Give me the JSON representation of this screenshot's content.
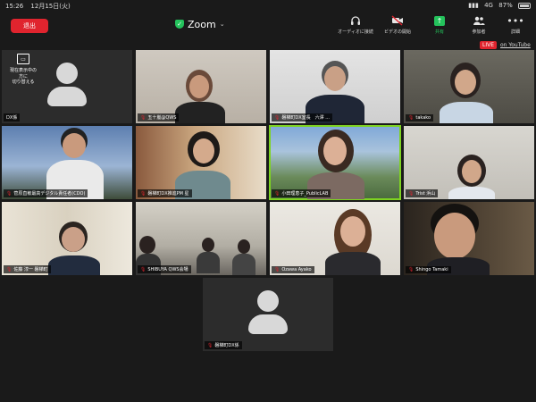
{
  "status": {
    "time": "15:26",
    "date": "12月15日(火)",
    "network": "4G",
    "battery": "87%"
  },
  "toolbar": {
    "leave_label": "退出",
    "title": "Zoom",
    "title_chevron": "⌄",
    "tools": [
      {
        "label": "オーディオに接続",
        "icon": "headphones-icon"
      },
      {
        "label": "ビデオの開始",
        "icon": "video-off-icon"
      },
      {
        "label": "共有",
        "icon": "share-icon"
      },
      {
        "label": "参加者",
        "icon": "participants-icon"
      },
      {
        "label": "詳細",
        "icon": "more-icon"
      }
    ]
  },
  "live": {
    "badge": "LIVE",
    "link": "on YouTube"
  },
  "rename_hint": {
    "line1": "現在表示中の",
    "line2": "方に",
    "line3": "切り替える"
  },
  "participants": [
    {
      "name": "DX係",
      "muted": false
    },
    {
      "name": "五十嵐@QWS",
      "muted": true
    },
    {
      "name": "磐梯町DX室長　六澤 ...",
      "muted": true
    },
    {
      "name": "takako",
      "muted": true
    },
    {
      "name": "菅原直敏最高デジタル責任者(CDO)",
      "muted": true
    },
    {
      "name": "磐梯町DX推進PM 星",
      "muted": true
    },
    {
      "name": "小田理恵子_PublicLAB",
      "muted": true
    },
    {
      "name": "Trist 浜山",
      "muted": true
    },
    {
      "name": "佐藤 淳一 磐梯町",
      "muted": true
    },
    {
      "name": "SHIBUYA QWS会場",
      "muted": true
    },
    {
      "name": "Ozawa Ayako",
      "muted": true
    },
    {
      "name": "Shingo Tamaki",
      "muted": true
    },
    {
      "name": "磐梯町DX係",
      "muted": true
    }
  ],
  "colors": {
    "leave": "#e0242e",
    "share": "#24c35c",
    "active_speaker": "#7ed321",
    "live": "#e0242e"
  }
}
